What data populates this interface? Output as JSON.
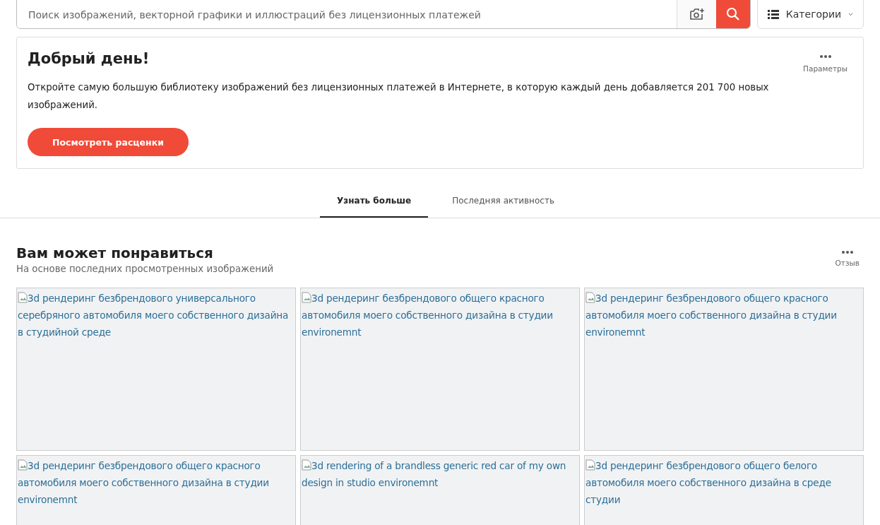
{
  "search": {
    "placeholder": "Поиск изображений, векторной графики и иллюстраций без лицензионных платежей"
  },
  "categories_button": {
    "label": "Категории"
  },
  "welcome": {
    "title": "Добрый день!",
    "text": "Откройте самую большую библиотеку изображений без лицензионных платежей в Интернете, в которую каждый день добавляется 201 700 новых изображений.",
    "button": "Посмотреть расценки",
    "options_label": "Параметры"
  },
  "tabs": [
    {
      "label": "Узнать больше",
      "selected": true
    },
    {
      "label": "Последняя активность",
      "selected": false
    }
  ],
  "section": {
    "title": "Вам может понравиться",
    "subtitle": "На основе последних просмотренных изображений",
    "feedback_label": "Отзыв"
  },
  "images": [
    {
      "alt": "3d рендеринг безбрендового универсального серебряного автомобиля моего собственного дизайна в студийной среде"
    },
    {
      "alt": "3d рендеринг безбрендового общего красного автомобиля моего собственного дизайна в студии environemnt"
    },
    {
      "alt": "3d рендеринг безбрендового общего красного автомобиля моего собственного дизайна в студии environemnt"
    },
    {
      "alt": "3d рендеринг безбрендового общего красного автомобиля моего собственного дизайна в студии environemnt"
    },
    {
      "alt": "3d rendering of a brandless generic red car of my own design in studio environemnt"
    },
    {
      "alt": "3d рендеринг безбрендового общего белого автомобиля моего собственного дизайна в среде студии"
    }
  ]
}
